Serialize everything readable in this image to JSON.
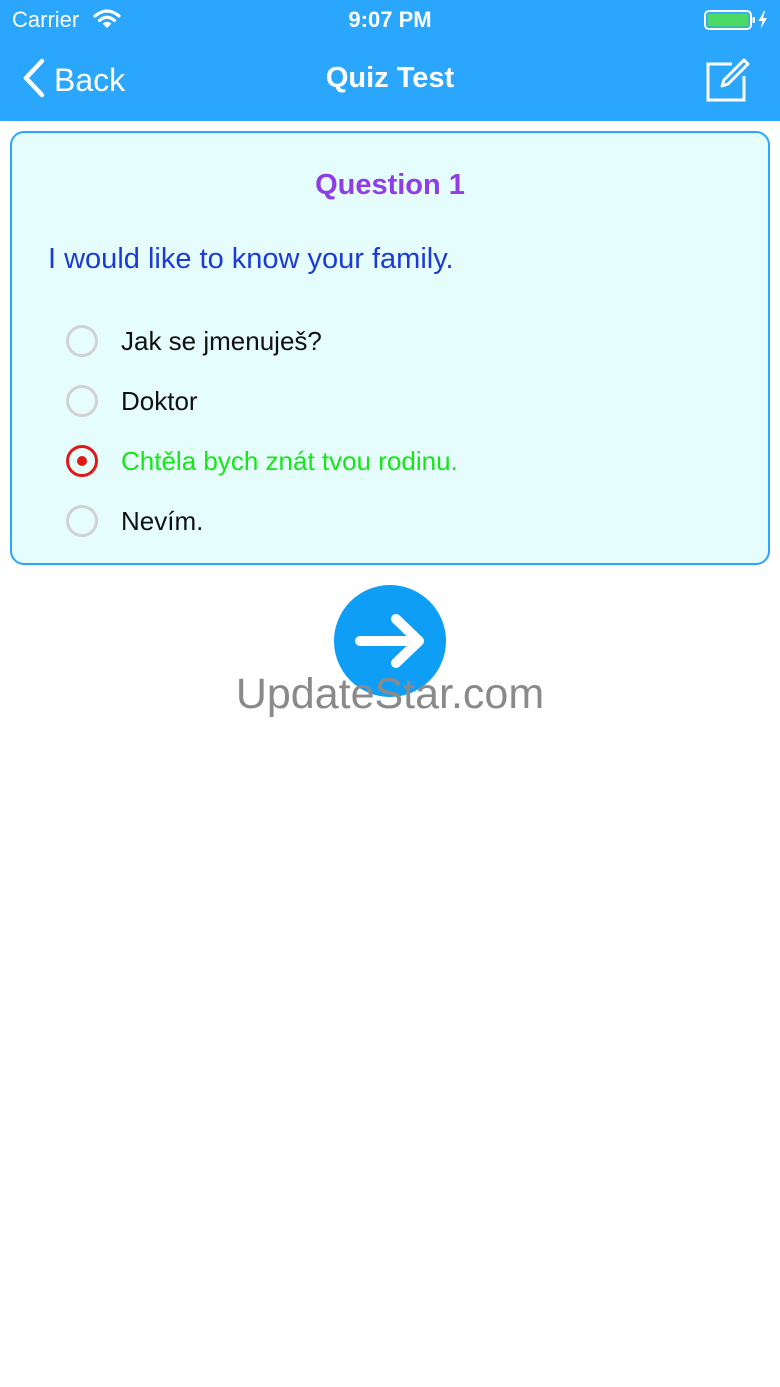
{
  "status_bar": {
    "carrier": "Carrier",
    "time": "9:07 PM"
  },
  "nav": {
    "back_label": "Back",
    "title": "Quiz Test",
    "edit_icon": "compose-icon"
  },
  "quiz": {
    "question_number": "Question 1",
    "question_text": "I would like to know your family.",
    "options": [
      {
        "label": "Jak se jmenuješ?",
        "selected": false
      },
      {
        "label": "Doktor",
        "selected": false
      },
      {
        "label": "Chtěla bych znát tvou rodinu.",
        "selected": true
      },
      {
        "label": "Nevím.",
        "selected": false
      }
    ],
    "next_icon": "arrow-right-icon"
  },
  "watermark": "UpdateStar.com",
  "colors": {
    "accent": "#2aa6fc",
    "card_background": "#e6fdfd",
    "question_number": "#8e3de8",
    "question_text": "#1b3ad6",
    "selected_radio": "#e31717",
    "correct_answer": "#16e616",
    "next_button": "#0f9ef6"
  }
}
